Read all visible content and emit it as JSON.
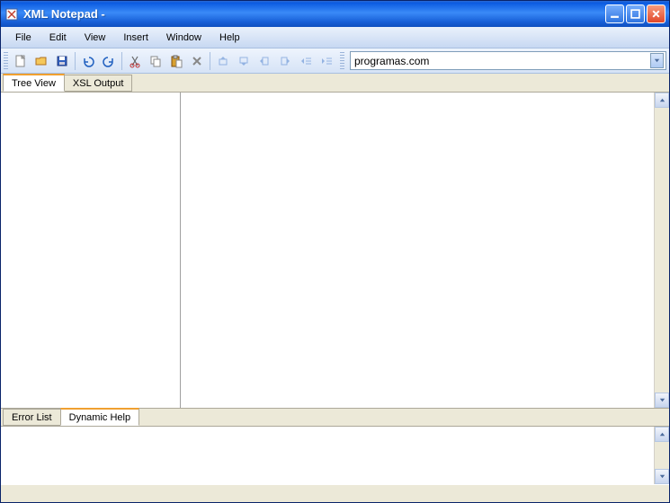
{
  "title": "XML Notepad -",
  "menu": [
    "File",
    "Edit",
    "View",
    "Insert",
    "Window",
    "Help"
  ],
  "url": "programas.com",
  "tabs_top": [
    {
      "label": "Tree View",
      "active": true
    },
    {
      "label": "XSL Output",
      "active": false
    }
  ],
  "tabs_bottom": [
    {
      "label": "Error List",
      "active": false
    },
    {
      "label": "Dynamic Help",
      "active": true
    }
  ],
  "toolbar_icons": [
    "new-file",
    "open-file",
    "save-file",
    "undo",
    "redo",
    "cut",
    "copy",
    "paste",
    "delete",
    "nudge-up",
    "nudge-down",
    "nudge-left",
    "nudge-right",
    "outdent",
    "indent"
  ]
}
